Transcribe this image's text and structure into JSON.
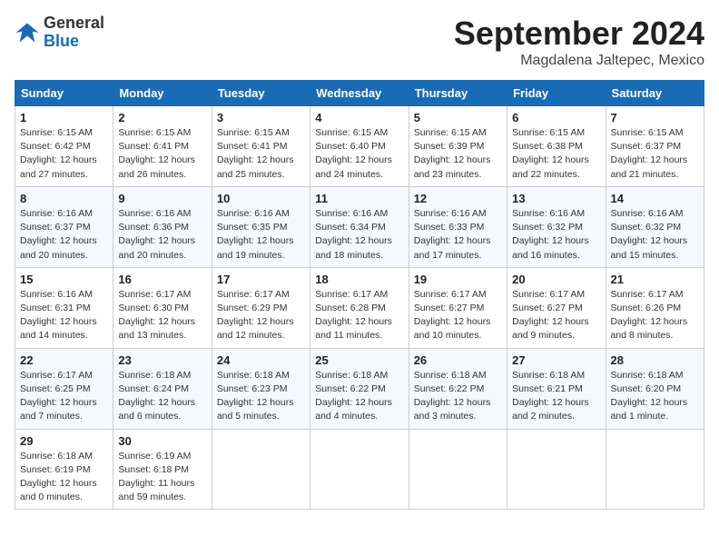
{
  "header": {
    "logo_line1": "General",
    "logo_line2": "Blue",
    "month": "September 2024",
    "location": "Magdalena Jaltepec, Mexico"
  },
  "days_of_week": [
    "Sunday",
    "Monday",
    "Tuesday",
    "Wednesday",
    "Thursday",
    "Friday",
    "Saturday"
  ],
  "weeks": [
    [
      {
        "day": "1",
        "info": "Sunrise: 6:15 AM\nSunset: 6:42 PM\nDaylight: 12 hours\nand 27 minutes."
      },
      {
        "day": "2",
        "info": "Sunrise: 6:15 AM\nSunset: 6:41 PM\nDaylight: 12 hours\nand 26 minutes."
      },
      {
        "day": "3",
        "info": "Sunrise: 6:15 AM\nSunset: 6:41 PM\nDaylight: 12 hours\nand 25 minutes."
      },
      {
        "day": "4",
        "info": "Sunrise: 6:15 AM\nSunset: 6:40 PM\nDaylight: 12 hours\nand 24 minutes."
      },
      {
        "day": "5",
        "info": "Sunrise: 6:15 AM\nSunset: 6:39 PM\nDaylight: 12 hours\nand 23 minutes."
      },
      {
        "day": "6",
        "info": "Sunrise: 6:15 AM\nSunset: 6:38 PM\nDaylight: 12 hours\nand 22 minutes."
      },
      {
        "day": "7",
        "info": "Sunrise: 6:15 AM\nSunset: 6:37 PM\nDaylight: 12 hours\nand 21 minutes."
      }
    ],
    [
      {
        "day": "8",
        "info": "Sunrise: 6:16 AM\nSunset: 6:37 PM\nDaylight: 12 hours\nand 20 minutes."
      },
      {
        "day": "9",
        "info": "Sunrise: 6:16 AM\nSunset: 6:36 PM\nDaylight: 12 hours\nand 20 minutes."
      },
      {
        "day": "10",
        "info": "Sunrise: 6:16 AM\nSunset: 6:35 PM\nDaylight: 12 hours\nand 19 minutes."
      },
      {
        "day": "11",
        "info": "Sunrise: 6:16 AM\nSunset: 6:34 PM\nDaylight: 12 hours\nand 18 minutes."
      },
      {
        "day": "12",
        "info": "Sunrise: 6:16 AM\nSunset: 6:33 PM\nDaylight: 12 hours\nand 17 minutes."
      },
      {
        "day": "13",
        "info": "Sunrise: 6:16 AM\nSunset: 6:32 PM\nDaylight: 12 hours\nand 16 minutes."
      },
      {
        "day": "14",
        "info": "Sunrise: 6:16 AM\nSunset: 6:32 PM\nDaylight: 12 hours\nand 15 minutes."
      }
    ],
    [
      {
        "day": "15",
        "info": "Sunrise: 6:16 AM\nSunset: 6:31 PM\nDaylight: 12 hours\nand 14 minutes."
      },
      {
        "day": "16",
        "info": "Sunrise: 6:17 AM\nSunset: 6:30 PM\nDaylight: 12 hours\nand 13 minutes."
      },
      {
        "day": "17",
        "info": "Sunrise: 6:17 AM\nSunset: 6:29 PM\nDaylight: 12 hours\nand 12 minutes."
      },
      {
        "day": "18",
        "info": "Sunrise: 6:17 AM\nSunset: 6:28 PM\nDaylight: 12 hours\nand 11 minutes."
      },
      {
        "day": "19",
        "info": "Sunrise: 6:17 AM\nSunset: 6:27 PM\nDaylight: 12 hours\nand 10 minutes."
      },
      {
        "day": "20",
        "info": "Sunrise: 6:17 AM\nSunset: 6:27 PM\nDaylight: 12 hours\nand 9 minutes."
      },
      {
        "day": "21",
        "info": "Sunrise: 6:17 AM\nSunset: 6:26 PM\nDaylight: 12 hours\nand 8 minutes."
      }
    ],
    [
      {
        "day": "22",
        "info": "Sunrise: 6:17 AM\nSunset: 6:25 PM\nDaylight: 12 hours\nand 7 minutes."
      },
      {
        "day": "23",
        "info": "Sunrise: 6:18 AM\nSunset: 6:24 PM\nDaylight: 12 hours\nand 6 minutes."
      },
      {
        "day": "24",
        "info": "Sunrise: 6:18 AM\nSunset: 6:23 PM\nDaylight: 12 hours\nand 5 minutes."
      },
      {
        "day": "25",
        "info": "Sunrise: 6:18 AM\nSunset: 6:22 PM\nDaylight: 12 hours\nand 4 minutes."
      },
      {
        "day": "26",
        "info": "Sunrise: 6:18 AM\nSunset: 6:22 PM\nDaylight: 12 hours\nand 3 minutes."
      },
      {
        "day": "27",
        "info": "Sunrise: 6:18 AM\nSunset: 6:21 PM\nDaylight: 12 hours\nand 2 minutes."
      },
      {
        "day": "28",
        "info": "Sunrise: 6:18 AM\nSunset: 6:20 PM\nDaylight: 12 hours\nand 1 minute."
      }
    ],
    [
      {
        "day": "29",
        "info": "Sunrise: 6:18 AM\nSunset: 6:19 PM\nDaylight: 12 hours\nand 0 minutes."
      },
      {
        "day": "30",
        "info": "Sunrise: 6:19 AM\nSunset: 6:18 PM\nDaylight: 11 hours\nand 59 minutes."
      },
      {
        "day": "",
        "info": ""
      },
      {
        "day": "",
        "info": ""
      },
      {
        "day": "",
        "info": ""
      },
      {
        "day": "",
        "info": ""
      },
      {
        "day": "",
        "info": ""
      }
    ]
  ]
}
